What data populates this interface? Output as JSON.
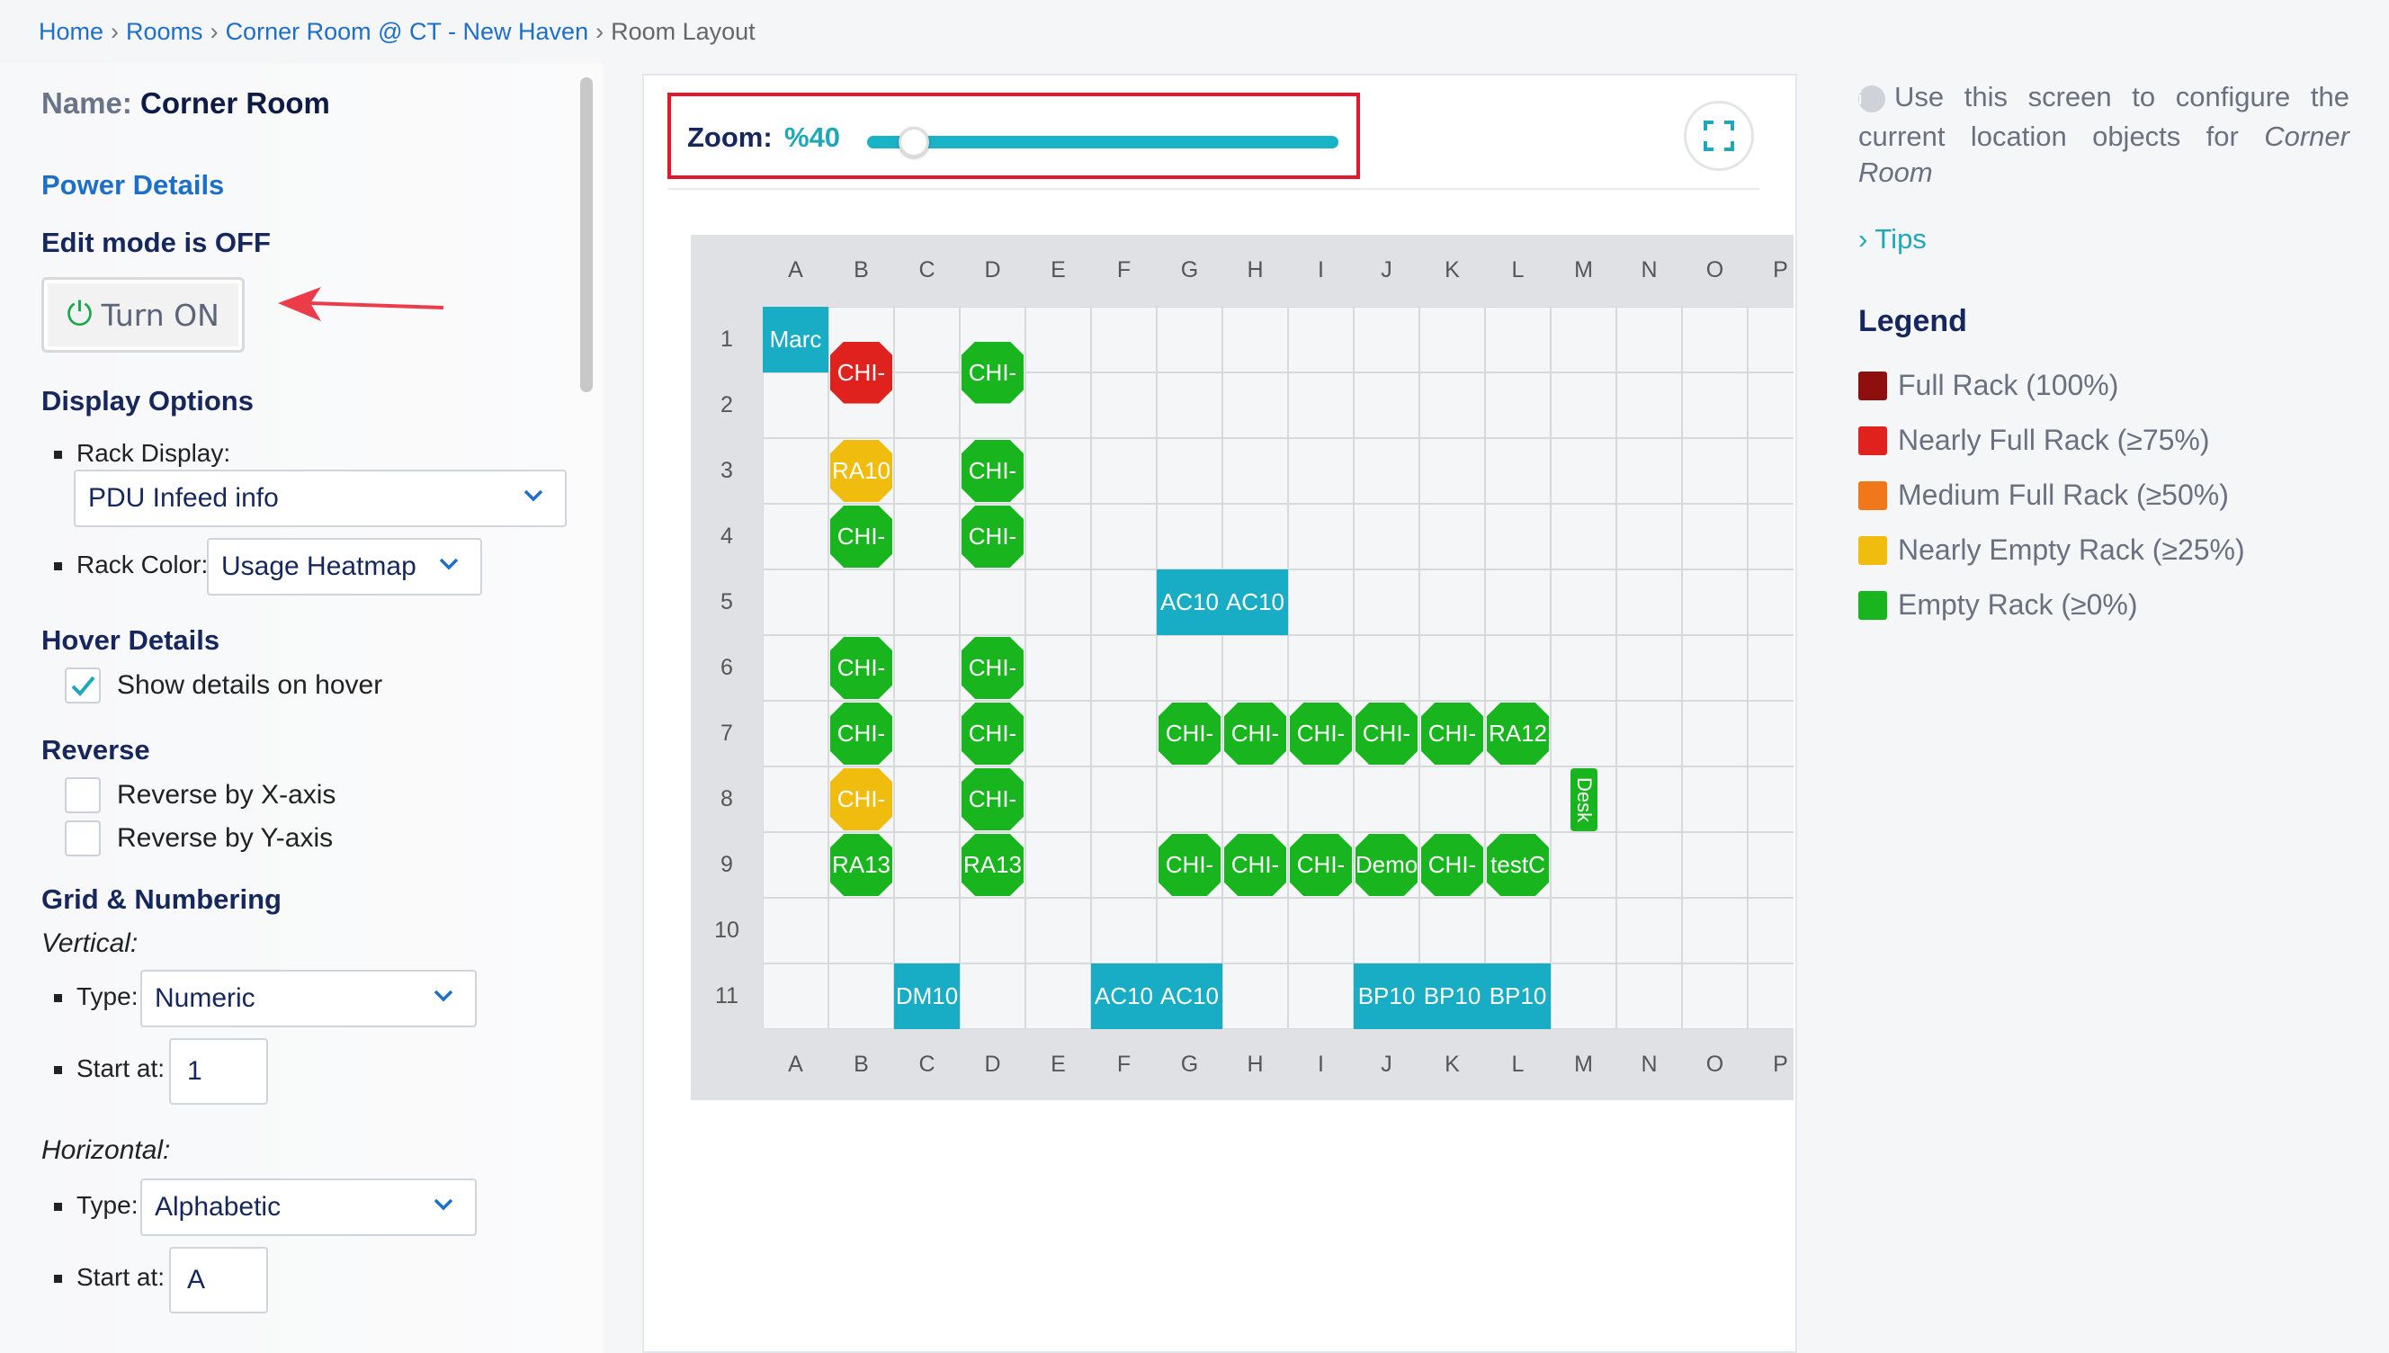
{
  "breadcrumb": {
    "home": "Home",
    "rooms": "Rooms",
    "location": "Corner Room @ CT - New Haven",
    "current": "Room Layout",
    "separator": "›"
  },
  "left": {
    "name_label": "Name:",
    "name_value": "Corner Room",
    "power_details": "Power Details",
    "edit_mode": "Edit mode is OFF",
    "turn_on": "Turn ON",
    "display_options": "Display Options",
    "rack_display_label": "Rack Display:",
    "rack_display_value": "PDU Infeed info",
    "rack_color_label": "Rack Color:",
    "rack_color_value": "Usage Heatmap",
    "hover_details": "Hover Details",
    "show_details": "Show details on hover",
    "show_details_checked": true,
    "reverse": "Reverse",
    "reverse_x": "Reverse by X-axis",
    "reverse_y": "Reverse by Y-axis",
    "grid_numbering": "Grid & Numbering",
    "vertical": "Vertical:",
    "vertical_type_label": "Type:",
    "vertical_type_value": "Numeric",
    "vertical_start_label": "Start at:",
    "vertical_start_value": "1",
    "horizontal": "Horizontal:",
    "horizontal_type_label": "Type:",
    "horizontal_type_value": "Alphabetic",
    "horizontal_start_label": "Start at:",
    "horizontal_start_value": "A"
  },
  "zoom": {
    "label": "Zoom:",
    "value": "%40",
    "level": 0.1
  },
  "grid": {
    "columns": [
      "A",
      "B",
      "C",
      "D",
      "E",
      "F",
      "G",
      "H",
      "I",
      "J",
      "K",
      "L",
      "M",
      "N",
      "O",
      "P"
    ],
    "rows": [
      "1",
      "2",
      "3",
      "4",
      "5",
      "6",
      "7",
      "8",
      "9",
      "10",
      "11"
    ],
    "objects": [
      {
        "label": "Marc",
        "col": "A",
        "row": "1",
        "shape": "rect",
        "color": "teal"
      },
      {
        "label": "CHI-",
        "col": "B",
        "row": "1.5",
        "shape": "oct",
        "color": "red"
      },
      {
        "label": "CHI-",
        "col": "D",
        "row": "1.5",
        "shape": "oct",
        "color": "green"
      },
      {
        "label": "RA10",
        "col": "B",
        "row": "3",
        "shape": "oct",
        "color": "yellow"
      },
      {
        "label": "CHI-",
        "col": "D",
        "row": "3",
        "shape": "oct",
        "color": "green"
      },
      {
        "label": "CHI-",
        "col": "B",
        "row": "4",
        "shape": "oct",
        "color": "green"
      },
      {
        "label": "CHI-",
        "col": "D",
        "row": "4",
        "shape": "oct",
        "color": "green"
      },
      {
        "label": "AC10",
        "col": "G",
        "row": "5",
        "shape": "rect",
        "color": "teal"
      },
      {
        "label": "AC10",
        "col": "H",
        "row": "5",
        "shape": "rect",
        "color": "teal"
      },
      {
        "label": "CHI-",
        "col": "B",
        "row": "6",
        "shape": "oct",
        "color": "green"
      },
      {
        "label": "CHI-",
        "col": "D",
        "row": "6",
        "shape": "oct",
        "color": "green"
      },
      {
        "label": "CHI-",
        "col": "B",
        "row": "7",
        "shape": "oct",
        "color": "green"
      },
      {
        "label": "CHI-",
        "col": "D",
        "row": "7",
        "shape": "oct",
        "color": "green"
      },
      {
        "label": "CHI-",
        "col": "G",
        "row": "7",
        "shape": "oct",
        "color": "green"
      },
      {
        "label": "CHI-",
        "col": "H",
        "row": "7",
        "shape": "oct",
        "color": "green"
      },
      {
        "label": "CHI-",
        "col": "I",
        "row": "7",
        "shape": "oct",
        "color": "green"
      },
      {
        "label": "CHI-",
        "col": "J",
        "row": "7",
        "shape": "oct",
        "color": "green"
      },
      {
        "label": "CHI-",
        "col": "K",
        "row": "7",
        "shape": "oct",
        "color": "green"
      },
      {
        "label": "RA12",
        "col": "L",
        "row": "7",
        "shape": "oct",
        "color": "green"
      },
      {
        "label": "CHI-",
        "col": "B",
        "row": "8",
        "shape": "oct",
        "color": "yellow"
      },
      {
        "label": "CHI-",
        "col": "D",
        "row": "8",
        "shape": "oct",
        "color": "green"
      },
      {
        "label": "Desk",
        "col": "M",
        "row": "8",
        "shape": "vert",
        "color": "green"
      },
      {
        "label": "RA13",
        "col": "B",
        "row": "9",
        "shape": "oct",
        "color": "green"
      },
      {
        "label": "RA13",
        "col": "D",
        "row": "9",
        "shape": "oct",
        "color": "green"
      },
      {
        "label": "CHI-",
        "col": "G",
        "row": "9",
        "shape": "oct",
        "color": "green"
      },
      {
        "label": "CHI-",
        "col": "H",
        "row": "9",
        "shape": "oct",
        "color": "green"
      },
      {
        "label": "CHI-",
        "col": "I",
        "row": "9",
        "shape": "oct",
        "color": "green"
      },
      {
        "label": "Demo",
        "col": "J",
        "row": "9",
        "shape": "oct",
        "color": "green"
      },
      {
        "label": "CHI-",
        "col": "K",
        "row": "9",
        "shape": "oct",
        "color": "green"
      },
      {
        "label": "testC",
        "col": "L",
        "row": "9",
        "shape": "oct",
        "color": "green"
      },
      {
        "label": "DM10",
        "col": "C",
        "row": "11",
        "shape": "rect",
        "color": "teal"
      },
      {
        "label": "AC10",
        "col": "F",
        "row": "11",
        "shape": "rect",
        "color": "teal"
      },
      {
        "label": "AC10",
        "col": "G",
        "row": "11",
        "shape": "rect",
        "color": "teal"
      },
      {
        "label": "BP10",
        "col": "J",
        "row": "11",
        "shape": "rect",
        "color": "teal"
      },
      {
        "label": "BP10",
        "col": "K",
        "row": "11",
        "shape": "rect",
        "color": "teal"
      },
      {
        "label": "BP10",
        "col": "L",
        "row": "11",
        "shape": "rect",
        "color": "teal"
      }
    ]
  },
  "right": {
    "info_text": "Use this screen to configure the current location objects for",
    "info_room": "Room",
    "info_corner": "Corner",
    "tips": "Tips",
    "legend_title": "Legend",
    "legend": [
      {
        "label": "Full Rack (100%)",
        "color": "#8f0e0e"
      },
      {
        "label": "Nearly Full Rack (≥75%)",
        "color": "#e0221f"
      },
      {
        "label": "Medium Full Rack (≥50%)",
        "color": "#f0781a"
      },
      {
        "label": "Nearly Empty Rack (≥25%)",
        "color": "#f0bd0f"
      },
      {
        "label": "Empty Rack (≥0%)",
        "color": "#19b51f"
      }
    ]
  }
}
